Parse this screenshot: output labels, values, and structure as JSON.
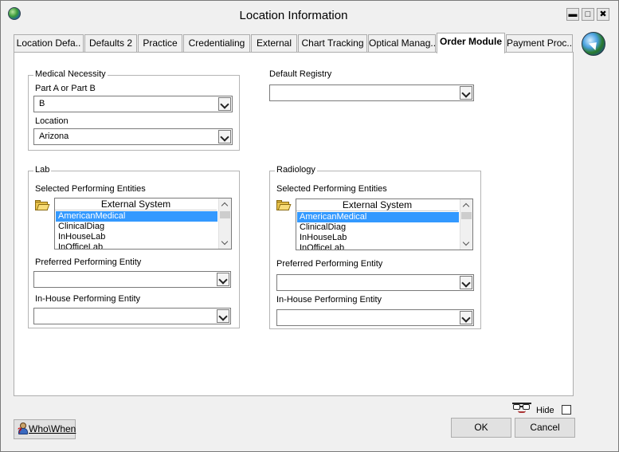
{
  "window": {
    "title": "Location Information",
    "controls": [
      "minimize",
      "maximize",
      "close"
    ]
  },
  "tabs": [
    {
      "label": "Location Defa..",
      "active": false
    },
    {
      "label": "Defaults 2",
      "active": false
    },
    {
      "label": "Practice",
      "active": false
    },
    {
      "label": "Credentialing",
      "active": false
    },
    {
      "label": "External",
      "active": false
    },
    {
      "label": "Chart Tracking",
      "active": false
    },
    {
      "label": "Optical Manag..",
      "active": false
    },
    {
      "label": "Order Module",
      "active": true
    },
    {
      "label": "Payment Proc..",
      "active": false
    }
  ],
  "medical_necessity": {
    "legend": "Medical Necessity",
    "part_label": "Part A or Part B",
    "part_value": "B",
    "location_label": "Location",
    "location_value": "Arizona"
  },
  "default_registry": {
    "label": "Default Registry",
    "value": ""
  },
  "lab": {
    "legend": "Lab",
    "selected_label": "Selected Performing Entities",
    "list_header": "External System",
    "items": [
      "AmericanMedical",
      "ClinicalDiag",
      "InHouseLab",
      "InOfficeLab"
    ],
    "selected_item": "AmericanMedical",
    "preferred_label": "Preferred Performing Entity",
    "preferred_value": "",
    "inhouse_label": "In-House Performing Entity",
    "inhouse_value": ""
  },
  "radiology": {
    "legend": "Radiology",
    "selected_label": "Selected Performing Entities",
    "list_header": "External System",
    "items": [
      "AmericanMedical",
      "ClinicalDiag",
      "InHouseLab",
      "InOfficeLab"
    ],
    "selected_item": "AmericanMedical",
    "preferred_label": "Preferred Performing Entity",
    "preferred_value": "",
    "inhouse_label": "In-House Performing Entity",
    "inhouse_value": ""
  },
  "footer": {
    "who_when_label": "Who\\When",
    "hide_label": "Hide",
    "hide_checked": false,
    "ok_label": "OK",
    "cancel_label": "Cancel"
  },
  "icons": {
    "app": "globe-icon",
    "tab_nav": "globe-arrow-icon",
    "folder": "open-folder-icon",
    "who_when": "person-question-icon",
    "hide": "glasses-icon"
  }
}
